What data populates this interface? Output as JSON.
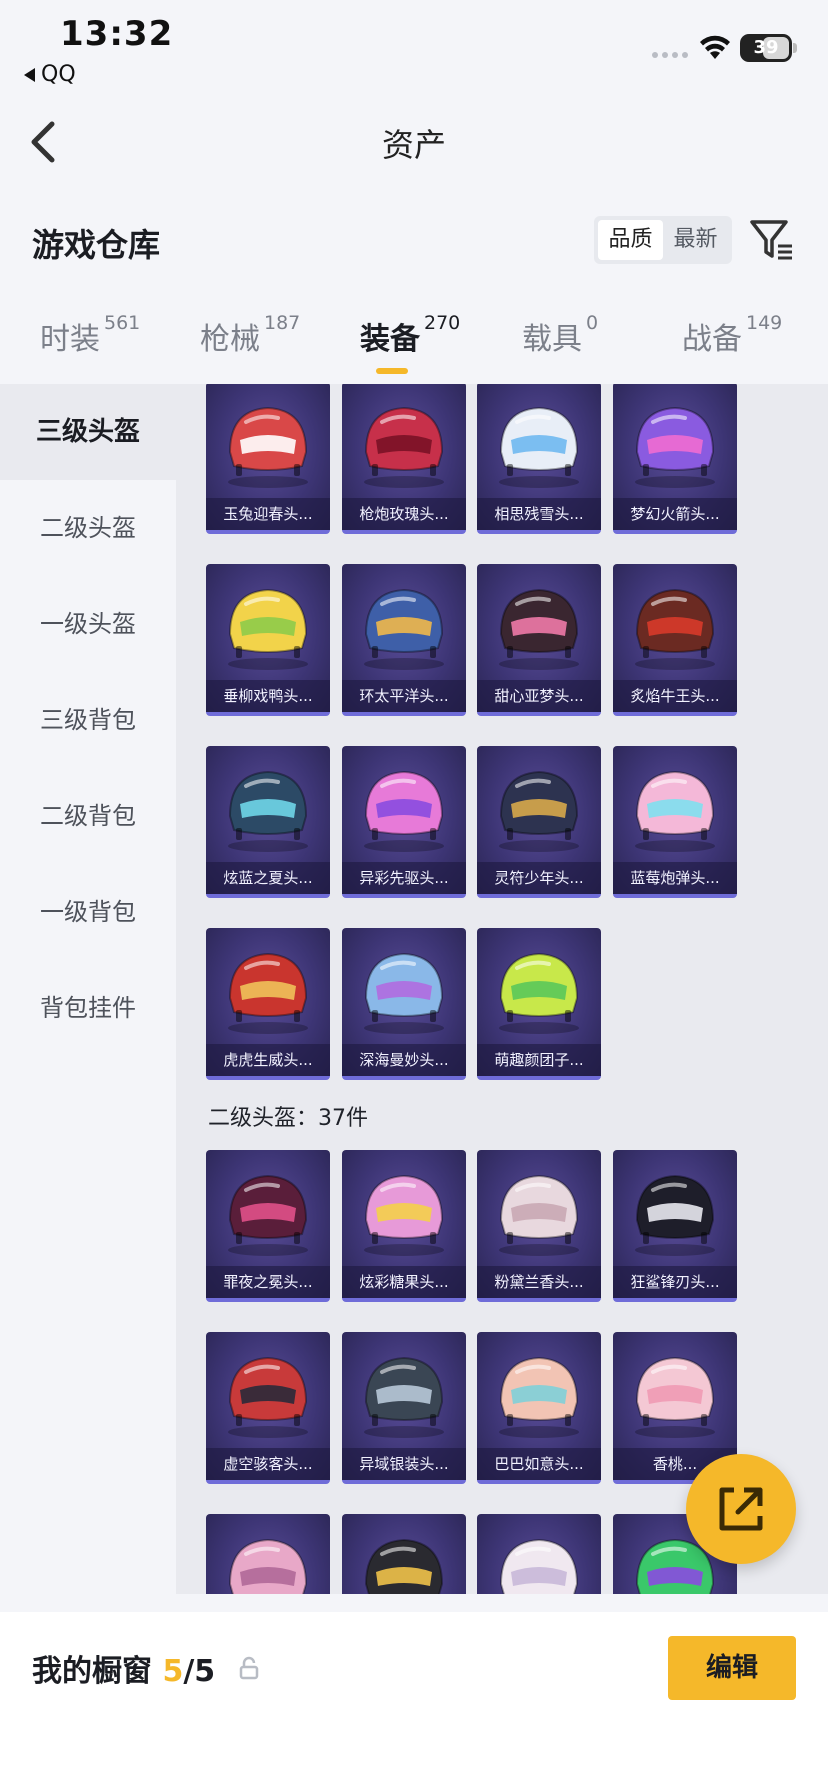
{
  "status_bar": {
    "time": "13:32",
    "back_app": "QQ",
    "battery": "39"
  },
  "nav": {
    "title": "资产"
  },
  "header": {
    "title": "游戏仓库",
    "sort_options": [
      "品质",
      "最新"
    ]
  },
  "tabs": [
    {
      "label": "时装",
      "count": "561"
    },
    {
      "label": "枪械",
      "count": "187"
    },
    {
      "label": "装备",
      "count": "270"
    },
    {
      "label": "载具",
      "count": "0"
    },
    {
      "label": "战备",
      "count": "149"
    }
  ],
  "sidebar": {
    "items": [
      "三级头盔",
      "二级头盔",
      "一级头盔",
      "三级背包",
      "二级背包",
      "一级背包",
      "背包挂件"
    ]
  },
  "level3_items": [
    {
      "name": "玉兔迎春头...",
      "color": "#d94848",
      "accent": "#ffffff"
    },
    {
      "name": "枪炮玫瑰头...",
      "color": "#c7304a",
      "accent": "#7a1226"
    },
    {
      "name": "相思残雪头...",
      "color": "#e8eef7",
      "accent": "#6fb8f0"
    },
    {
      "name": "梦幻火箭头...",
      "color": "#8a5be0",
      "accent": "#f06bd1"
    },
    {
      "name": "垂柳戏鸭头...",
      "color": "#f2d34a",
      "accent": "#8ecb4a"
    },
    {
      "name": "环太平洋头...",
      "color": "#3e5fa8",
      "accent": "#f0b84a"
    },
    {
      "name": "甜心亚梦头...",
      "color": "#3a2630",
      "accent": "#f07aa8"
    },
    {
      "name": "炙焰牛王头...",
      "color": "#6b2a22",
      "accent": "#d83a2a"
    },
    {
      "name": "炫蓝之夏头...",
      "color": "#2c4a66",
      "accent": "#6fd6e8"
    },
    {
      "name": "异彩先驱头...",
      "color": "#e77ad8",
      "accent": "#8a4be0"
    },
    {
      "name": "灵符少年头...",
      "color": "#2d3350",
      "accent": "#d8a84a"
    },
    {
      "name": "蓝莓炮弹头...",
      "color": "#f4b8d8",
      "accent": "#7fe0f0"
    },
    {
      "name": "虎虎生威头...",
      "color": "#c9352e",
      "accent": "#f0c25a"
    },
    {
      "name": "深海曼妙头...",
      "color": "#8ab8e8",
      "accent": "#b06be0"
    },
    {
      "name": "萌趣颜团子...",
      "color": "#c8e84a",
      "accent": "#5ac85a"
    }
  ],
  "level2_section": {
    "title": "二级头盔：37件"
  },
  "level2_items": [
    {
      "name": "罪夜之冕头...",
      "color": "#5a1e3a",
      "accent": "#e0508a"
    },
    {
      "name": "炫彩糖果头...",
      "color": "#e79ad8",
      "accent": "#f4d04a"
    },
    {
      "name": "粉黛兰香头...",
      "color": "#e8d8de",
      "accent": "#c9a8b4"
    },
    {
      "name": "狂鲨锋刃头...",
      "color": "#1e1e2a",
      "accent": "#e8e8f0"
    },
    {
      "name": "虚空骇客头...",
      "color": "#c83a3a",
      "accent": "#2a2a3a"
    },
    {
      "name": "异域银装头...",
      "color": "#3a4654",
      "accent": "#b8c8d8"
    },
    {
      "name": "巴巴如意头...",
      "color": "#f2c4b4",
      "accent": "#7fd0d8"
    },
    {
      "name": "香桃...",
      "color": "#f4c8d4",
      "accent": "#f09ab4"
    },
    {
      "name": "",
      "color": "#e8a8c8",
      "accent": "#b06898"
    },
    {
      "name": "",
      "color": "#2a2a30",
      "accent": "#f0c24a"
    },
    {
      "name": "",
      "color": "#f0e8f0",
      "accent": "#c8b8d8"
    },
    {
      "name": "",
      "color": "#3ac86a",
      "accent": "#8a4be0"
    }
  ],
  "showcase": {
    "label": "我的橱窗",
    "current": "5",
    "total": "/5"
  },
  "edit_label": "编辑"
}
